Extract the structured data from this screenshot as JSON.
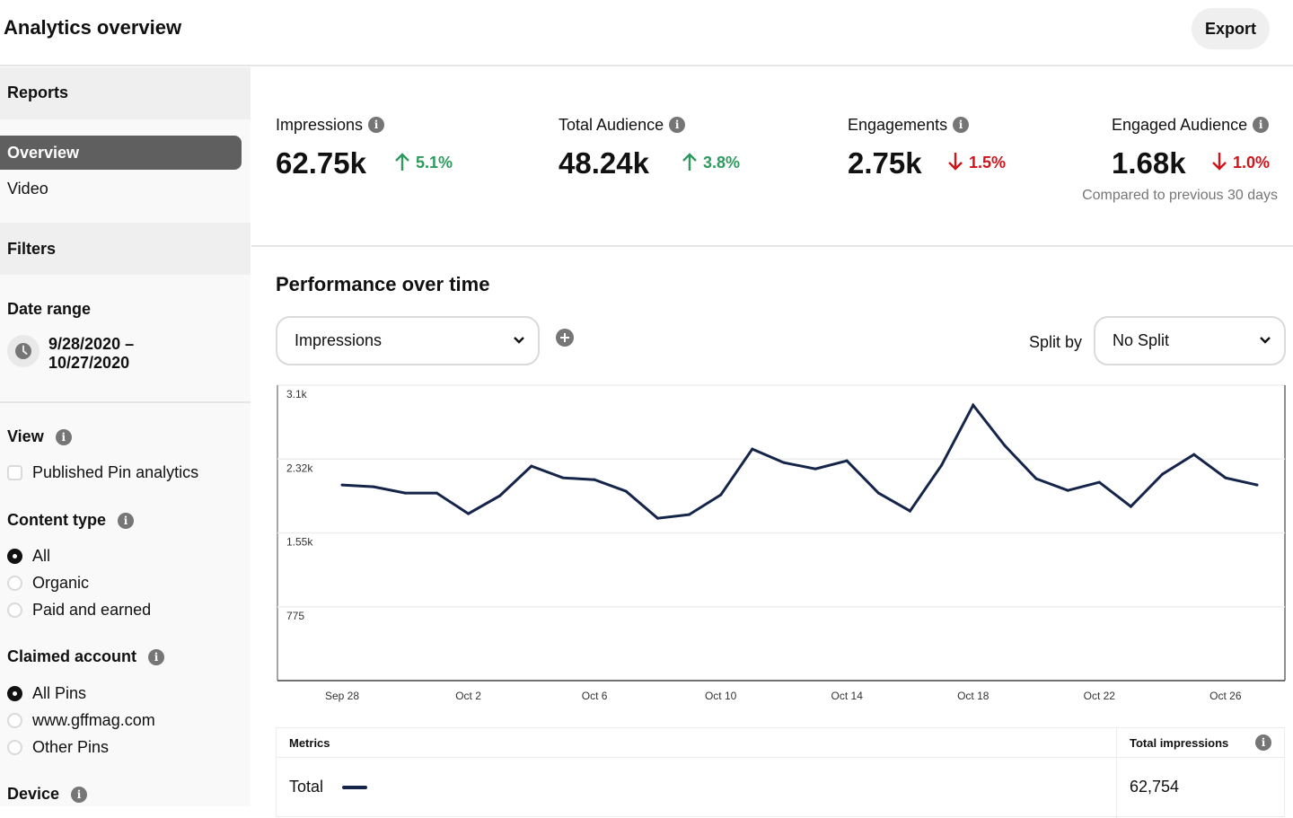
{
  "header": {
    "title": "Analytics overview",
    "export_label": "Export"
  },
  "sidebar": {
    "reports_heading": "Reports",
    "nav": [
      {
        "label": "Overview",
        "active": true
      },
      {
        "label": "Video",
        "active": false
      }
    ],
    "filters_heading": "Filters",
    "date_range": {
      "label": "Date range",
      "start": "9/28/2020 –",
      "end": "10/27/2020",
      "icon": "clock-icon"
    },
    "view": {
      "label": "View",
      "options": [
        {
          "label": "Published Pin analytics",
          "checked": false
        }
      ]
    },
    "content_type": {
      "label": "Content type",
      "options": [
        {
          "label": "All",
          "selected": true
        },
        {
          "label": "Organic",
          "selected": false
        },
        {
          "label": "Paid and earned",
          "selected": false
        }
      ]
    },
    "claimed_account": {
      "label": "Claimed account",
      "options": [
        {
          "label": "All Pins",
          "selected": true
        },
        {
          "label": "www.gffmag.com",
          "selected": false
        },
        {
          "label": "Other Pins",
          "selected": false
        }
      ]
    },
    "device": {
      "label": "Device"
    }
  },
  "stats": [
    {
      "label": "Impressions",
      "value": "62.75k",
      "delta": "5.1%",
      "direction": "up"
    },
    {
      "label": "Total Audience",
      "value": "48.24k",
      "delta": "3.8%",
      "direction": "up"
    },
    {
      "label": "Engagements",
      "value": "2.75k",
      "delta": "1.5%",
      "direction": "down"
    },
    {
      "label": "Engaged Audience",
      "value": "1.68k",
      "delta": "1.0%",
      "direction": "down"
    }
  ],
  "compare_note": "Compared to previous 30 days",
  "performance": {
    "title": "Performance over time",
    "metric_select": "Impressions",
    "split_label": "Split by",
    "split_select": "No Split"
  },
  "colors": {
    "up": "#2e9a5e",
    "down": "#d0141b",
    "line": "#15254a",
    "active_nav": "#5f5f5f"
  },
  "chart_data": {
    "type": "line",
    "title": "",
    "xlabel": "",
    "ylabel": "",
    "ylim": [
      0,
      3100
    ],
    "yticks": [
      775,
      1550,
      2325,
      3100
    ],
    "ytick_labels": [
      "775",
      "1.55k",
      "2.32k",
      "3.1k"
    ],
    "xtick_labels": [
      "Sep 28",
      "Oct 2",
      "Oct 6",
      "Oct 10",
      "Oct 14",
      "Oct 18",
      "Oct 22",
      "Oct 26"
    ],
    "xtick_indices": [
      0,
      4,
      8,
      12,
      16,
      20,
      24,
      28
    ],
    "grid": true,
    "legend": "none",
    "x": [
      "Sep 28",
      "Sep 29",
      "Sep 30",
      "Oct 1",
      "Oct 2",
      "Oct 3",
      "Oct 4",
      "Oct 5",
      "Oct 6",
      "Oct 7",
      "Oct 8",
      "Oct 9",
      "Oct 10",
      "Oct 11",
      "Oct 12",
      "Oct 13",
      "Oct 14",
      "Oct 15",
      "Oct 16",
      "Oct 17",
      "Oct 18",
      "Oct 19",
      "Oct 20",
      "Oct 21",
      "Oct 22",
      "Oct 23",
      "Oct 24",
      "Oct 25",
      "Oct 26",
      "Oct 27"
    ],
    "series": [
      {
        "name": "Total",
        "values": [
          2053,
          2034,
          1968,
          1968,
          1752,
          1940,
          2251,
          2128,
          2109,
          1987,
          1704,
          1742,
          1949,
          2430,
          2288,
          2222,
          2307,
          1968,
          1780,
          2260,
          2891,
          2467,
          2119,
          1996,
          2081,
          1827,
          2166,
          2373,
          2128,
          2053
        ]
      }
    ]
  },
  "table": {
    "headers": [
      "Metrics",
      "Total impressions"
    ],
    "rows": [
      {
        "metric": "Total",
        "value": "62,754"
      }
    ]
  }
}
